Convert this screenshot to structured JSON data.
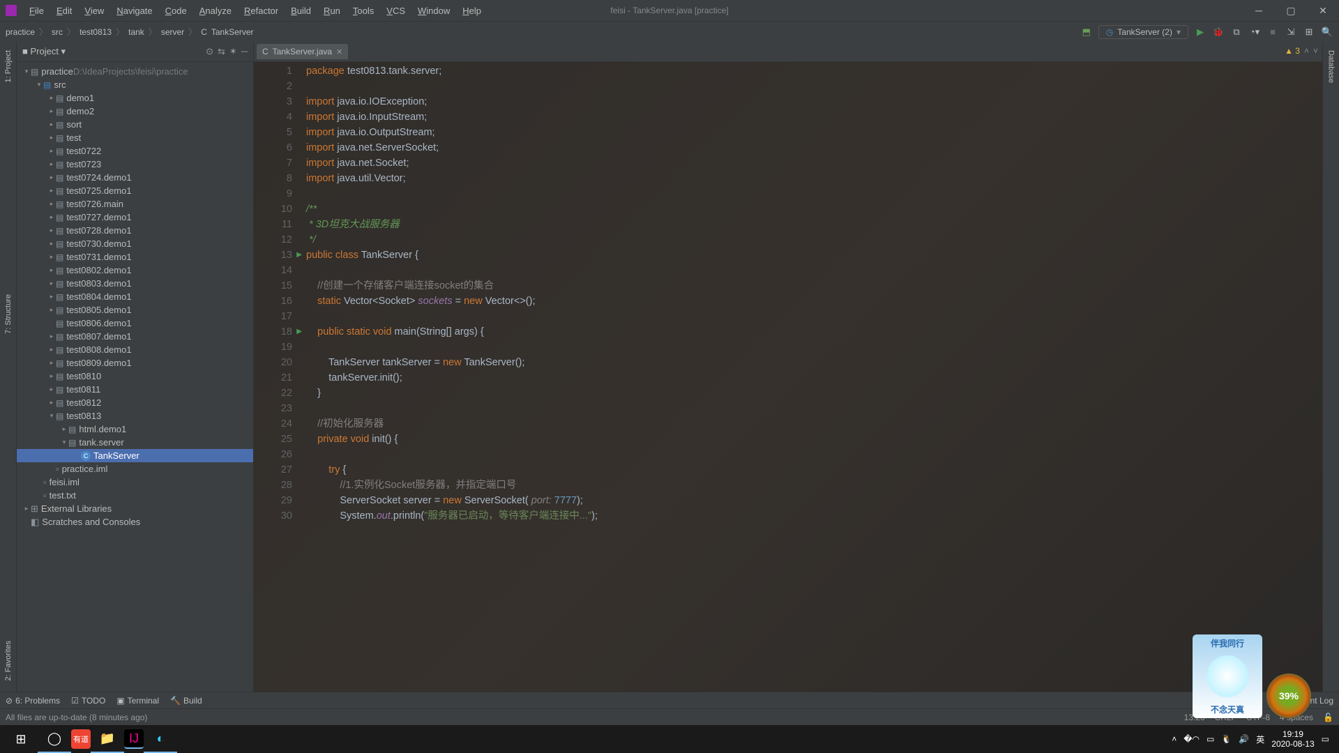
{
  "window": {
    "title": "feisi - TankServer.java [practice]"
  },
  "menu": [
    "File",
    "Edit",
    "View",
    "Navigate",
    "Code",
    "Analyze",
    "Refactor",
    "Build",
    "Run",
    "Tools",
    "VCS",
    "Window",
    "Help"
  ],
  "breadcrumbs": [
    "practice",
    "src",
    "test0813",
    "tank",
    "server",
    "TankServer"
  ],
  "runConfig": "TankServer (2)",
  "projectPanel": {
    "title": "Project"
  },
  "tree": [
    {
      "d": 0,
      "a": "v",
      "ic": "mod",
      "t": "practice",
      "suffix": "  D:\\IdeaProjects\\feisi\\practice"
    },
    {
      "d": 1,
      "a": "v",
      "ic": "src",
      "t": "src"
    },
    {
      "d": 2,
      "a": ">",
      "ic": "pkg",
      "t": "demo1"
    },
    {
      "d": 2,
      "a": ">",
      "ic": "pkg",
      "t": "demo2"
    },
    {
      "d": 2,
      "a": ">",
      "ic": "pkg",
      "t": "sort"
    },
    {
      "d": 2,
      "a": ">",
      "ic": "pkg",
      "t": "test"
    },
    {
      "d": 2,
      "a": ">",
      "ic": "pkg",
      "t": "test0722"
    },
    {
      "d": 2,
      "a": ">",
      "ic": "pkg",
      "t": "test0723"
    },
    {
      "d": 2,
      "a": ">",
      "ic": "pkg",
      "t": "test0724.demo1"
    },
    {
      "d": 2,
      "a": ">",
      "ic": "pkg",
      "t": "test0725.demo1"
    },
    {
      "d": 2,
      "a": ">",
      "ic": "pkg",
      "t": "test0726.main"
    },
    {
      "d": 2,
      "a": ">",
      "ic": "pkg",
      "t": "test0727.demo1"
    },
    {
      "d": 2,
      "a": ">",
      "ic": "pkg",
      "t": "test0728.demo1"
    },
    {
      "d": 2,
      "a": ">",
      "ic": "pkg",
      "t": "test0730.demo1"
    },
    {
      "d": 2,
      "a": ">",
      "ic": "pkg",
      "t": "test0731.demo1"
    },
    {
      "d": 2,
      "a": ">",
      "ic": "pkg",
      "t": "test0802.demo1"
    },
    {
      "d": 2,
      "a": ">",
      "ic": "pkg",
      "t": "test0803.demo1"
    },
    {
      "d": 2,
      "a": ">",
      "ic": "pkg",
      "t": "test0804.demo1"
    },
    {
      "d": 2,
      "a": ">",
      "ic": "pkg",
      "t": "test0805.demo1"
    },
    {
      "d": 2,
      "a": " ",
      "ic": "pkg",
      "t": "test0806.demo1"
    },
    {
      "d": 2,
      "a": ">",
      "ic": "pkg",
      "t": "test0807.demo1"
    },
    {
      "d": 2,
      "a": ">",
      "ic": "pkg",
      "t": "test0808.demo1"
    },
    {
      "d": 2,
      "a": ">",
      "ic": "pkg",
      "t": "test0809.demo1"
    },
    {
      "d": 2,
      "a": ">",
      "ic": "pkg",
      "t": "test0810"
    },
    {
      "d": 2,
      "a": ">",
      "ic": "pkg",
      "t": "test0811"
    },
    {
      "d": 2,
      "a": ">",
      "ic": "pkg",
      "t": "test0812"
    },
    {
      "d": 2,
      "a": "v",
      "ic": "pkg",
      "t": "test0813"
    },
    {
      "d": 3,
      "a": ">",
      "ic": "pkg",
      "t": "html.demo1"
    },
    {
      "d": 3,
      "a": "v",
      "ic": "pkg",
      "t": "tank.server"
    },
    {
      "d": 4,
      "a": " ",
      "ic": "cls",
      "t": "TankServer",
      "sel": true
    },
    {
      "d": 2,
      "a": " ",
      "ic": "file",
      "t": "practice.iml"
    },
    {
      "d": 1,
      "a": " ",
      "ic": "file",
      "t": "feisi.iml"
    },
    {
      "d": 1,
      "a": " ",
      "ic": "file",
      "t": "test.txt"
    },
    {
      "d": 0,
      "a": ">",
      "ic": "lib",
      "t": "External Libraries"
    },
    {
      "d": 0,
      "a": " ",
      "ic": "scratch",
      "t": "Scratches and Consoles"
    }
  ],
  "editorTab": {
    "name": "TankServer.java"
  },
  "code": {
    "lines": [
      {
        "n": 1,
        "html": "<span class='kw'>package</span> test0813.tank.server;"
      },
      {
        "n": 2,
        "html": ""
      },
      {
        "n": 3,
        "html": "<span class='kw'>import</span> java.io.IOException;"
      },
      {
        "n": 4,
        "html": "<span class='kw'>import</span> java.io.InputStream;"
      },
      {
        "n": 5,
        "html": "<span class='kw'>import</span> java.io.OutputStream;"
      },
      {
        "n": 6,
        "html": "<span class='kw'>import</span> java.net.ServerSocket;"
      },
      {
        "n": 7,
        "html": "<span class='kw'>import</span> java.net.Socket;"
      },
      {
        "n": 8,
        "html": "<span class='kw'>import</span> java.util.Vector;"
      },
      {
        "n": 9,
        "html": ""
      },
      {
        "n": 10,
        "html": "<span class='doc'>/**</span>"
      },
      {
        "n": 11,
        "html": "<span class='doc'> * 3D坦克大战服务器</span>"
      },
      {
        "n": 12,
        "html": "<span class='doc'> */</span>"
      },
      {
        "n": 13,
        "html": "<span class='kw'>public class</span> TankServer {",
        "run": true
      },
      {
        "n": 14,
        "html": ""
      },
      {
        "n": 15,
        "html": "    <span class='cmt'>//创建一个存储客户端连接socket的集合</span>"
      },
      {
        "n": 16,
        "html": "    <span class='kw'>static</span> Vector&lt;Socket&gt; <span class='fld'>sockets</span> = <span class='kw'>new</span> Vector&lt;&gt;();"
      },
      {
        "n": 17,
        "html": ""
      },
      {
        "n": 18,
        "html": "    <span class='kw'>public static void</span> main(String[] args) {",
        "run": true
      },
      {
        "n": 19,
        "html": ""
      },
      {
        "n": 20,
        "html": "        TankServer tankServer = <span class='kw'>new</span> TankServer();"
      },
      {
        "n": 21,
        "html": "        tankServer.init();"
      },
      {
        "n": 22,
        "html": "    }"
      },
      {
        "n": 23,
        "html": ""
      },
      {
        "n": 24,
        "html": "    <span class='cmt'>//初始化服务器</span>"
      },
      {
        "n": 25,
        "html": "    <span class='kw'>private void</span> init() {"
      },
      {
        "n": 26,
        "html": ""
      },
      {
        "n": 27,
        "html": "        <span class='kw'>try</span> {"
      },
      {
        "n": 28,
        "html": "            <span class='cmt'>//1.实例化Socket服务器，并指定端口号</span>"
      },
      {
        "n": 29,
        "html": "            ServerSocket server = <span class='kw'>new</span> ServerSocket( <span class='param'>port:</span> <span class='num'>7777</span>);"
      },
      {
        "n": 30,
        "html": "            System.<span class='fld'>out</span>.println(<span class='str'>\"服务器已启动，等待客户端连接中...\"</span>);"
      }
    ]
  },
  "inspection": {
    "warnings": 3
  },
  "leftTabs": [
    "1: Project",
    "7: Structure",
    "2: Favorites"
  ],
  "rightTabs": [
    "Database"
  ],
  "bottomTabs": [
    "6: Problems",
    "TODO",
    "Terminal",
    "Build"
  ],
  "status": {
    "msg": "All files are up-to-date (8 minutes ago)",
    "pos": "13:26",
    "encoding": "UTF-8",
    "indent": "4 spaces",
    "sep": "CRLF"
  },
  "taskbar": {
    "tray": {
      "ime": "英",
      "time": "19:19",
      "date": "2020-08-13"
    },
    "gauge": "39%"
  },
  "widget": {
    "top": "伴我同行",
    "bottom": "不念天真"
  }
}
